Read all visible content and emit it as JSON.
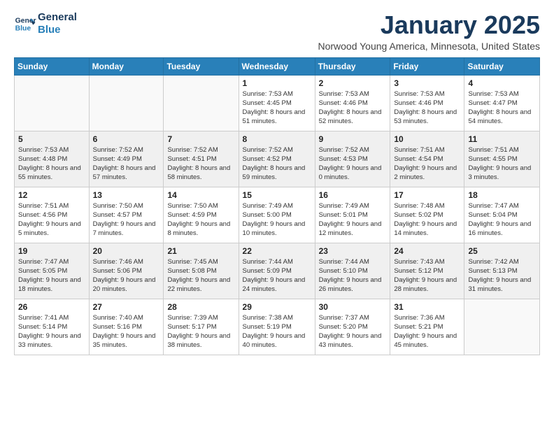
{
  "logo": {
    "line1": "General",
    "line2": "Blue"
  },
  "title": "January 2025",
  "location": "Norwood Young America, Minnesota, United States",
  "days_of_week": [
    "Sunday",
    "Monday",
    "Tuesday",
    "Wednesday",
    "Thursday",
    "Friday",
    "Saturday"
  ],
  "weeks": [
    [
      {
        "day": "",
        "info": ""
      },
      {
        "day": "",
        "info": ""
      },
      {
        "day": "",
        "info": ""
      },
      {
        "day": "1",
        "info": "Sunrise: 7:53 AM\nSunset: 4:45 PM\nDaylight: 8 hours and 51 minutes."
      },
      {
        "day": "2",
        "info": "Sunrise: 7:53 AM\nSunset: 4:46 PM\nDaylight: 8 hours and 52 minutes."
      },
      {
        "day": "3",
        "info": "Sunrise: 7:53 AM\nSunset: 4:46 PM\nDaylight: 8 hours and 53 minutes."
      },
      {
        "day": "4",
        "info": "Sunrise: 7:53 AM\nSunset: 4:47 PM\nDaylight: 8 hours and 54 minutes."
      }
    ],
    [
      {
        "day": "5",
        "info": "Sunrise: 7:53 AM\nSunset: 4:48 PM\nDaylight: 8 hours and 55 minutes."
      },
      {
        "day": "6",
        "info": "Sunrise: 7:52 AM\nSunset: 4:49 PM\nDaylight: 8 hours and 57 minutes."
      },
      {
        "day": "7",
        "info": "Sunrise: 7:52 AM\nSunset: 4:51 PM\nDaylight: 8 hours and 58 minutes."
      },
      {
        "day": "8",
        "info": "Sunrise: 7:52 AM\nSunset: 4:52 PM\nDaylight: 8 hours and 59 minutes."
      },
      {
        "day": "9",
        "info": "Sunrise: 7:52 AM\nSunset: 4:53 PM\nDaylight: 9 hours and 0 minutes."
      },
      {
        "day": "10",
        "info": "Sunrise: 7:51 AM\nSunset: 4:54 PM\nDaylight: 9 hours and 2 minutes."
      },
      {
        "day": "11",
        "info": "Sunrise: 7:51 AM\nSunset: 4:55 PM\nDaylight: 9 hours and 3 minutes."
      }
    ],
    [
      {
        "day": "12",
        "info": "Sunrise: 7:51 AM\nSunset: 4:56 PM\nDaylight: 9 hours and 5 minutes."
      },
      {
        "day": "13",
        "info": "Sunrise: 7:50 AM\nSunset: 4:57 PM\nDaylight: 9 hours and 7 minutes."
      },
      {
        "day": "14",
        "info": "Sunrise: 7:50 AM\nSunset: 4:59 PM\nDaylight: 9 hours and 8 minutes."
      },
      {
        "day": "15",
        "info": "Sunrise: 7:49 AM\nSunset: 5:00 PM\nDaylight: 9 hours and 10 minutes."
      },
      {
        "day": "16",
        "info": "Sunrise: 7:49 AM\nSunset: 5:01 PM\nDaylight: 9 hours and 12 minutes."
      },
      {
        "day": "17",
        "info": "Sunrise: 7:48 AM\nSunset: 5:02 PM\nDaylight: 9 hours and 14 minutes."
      },
      {
        "day": "18",
        "info": "Sunrise: 7:47 AM\nSunset: 5:04 PM\nDaylight: 9 hours and 16 minutes."
      }
    ],
    [
      {
        "day": "19",
        "info": "Sunrise: 7:47 AM\nSunset: 5:05 PM\nDaylight: 9 hours and 18 minutes."
      },
      {
        "day": "20",
        "info": "Sunrise: 7:46 AM\nSunset: 5:06 PM\nDaylight: 9 hours and 20 minutes."
      },
      {
        "day": "21",
        "info": "Sunrise: 7:45 AM\nSunset: 5:08 PM\nDaylight: 9 hours and 22 minutes."
      },
      {
        "day": "22",
        "info": "Sunrise: 7:44 AM\nSunset: 5:09 PM\nDaylight: 9 hours and 24 minutes."
      },
      {
        "day": "23",
        "info": "Sunrise: 7:44 AM\nSunset: 5:10 PM\nDaylight: 9 hours and 26 minutes."
      },
      {
        "day": "24",
        "info": "Sunrise: 7:43 AM\nSunset: 5:12 PM\nDaylight: 9 hours and 28 minutes."
      },
      {
        "day": "25",
        "info": "Sunrise: 7:42 AM\nSunset: 5:13 PM\nDaylight: 9 hours and 31 minutes."
      }
    ],
    [
      {
        "day": "26",
        "info": "Sunrise: 7:41 AM\nSunset: 5:14 PM\nDaylight: 9 hours and 33 minutes."
      },
      {
        "day": "27",
        "info": "Sunrise: 7:40 AM\nSunset: 5:16 PM\nDaylight: 9 hours and 35 minutes."
      },
      {
        "day": "28",
        "info": "Sunrise: 7:39 AM\nSunset: 5:17 PM\nDaylight: 9 hours and 38 minutes."
      },
      {
        "day": "29",
        "info": "Sunrise: 7:38 AM\nSunset: 5:19 PM\nDaylight: 9 hours and 40 minutes."
      },
      {
        "day": "30",
        "info": "Sunrise: 7:37 AM\nSunset: 5:20 PM\nDaylight: 9 hours and 43 minutes."
      },
      {
        "day": "31",
        "info": "Sunrise: 7:36 AM\nSunset: 5:21 PM\nDaylight: 9 hours and 45 minutes."
      },
      {
        "day": "",
        "info": ""
      }
    ]
  ]
}
